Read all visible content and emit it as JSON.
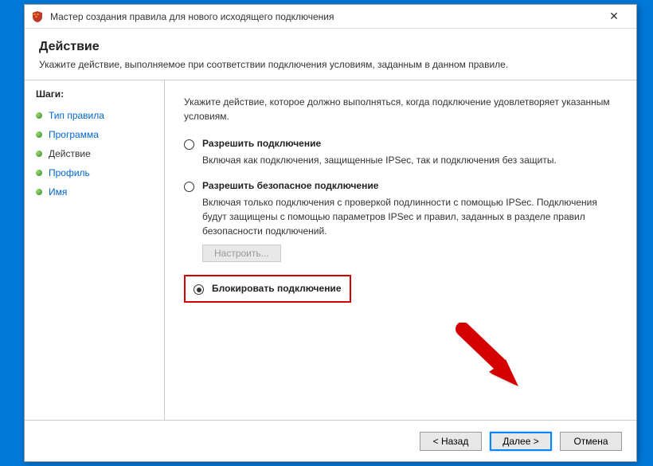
{
  "window": {
    "title": "Мастер создания правила для нового исходящего подключения",
    "close_symbol": "✕"
  },
  "header": {
    "title": "Действие",
    "subtitle": "Укажите действие, выполняемое при соответствии подключения условиям, заданным в данном правиле."
  },
  "sidebar": {
    "title": "Шаги:",
    "steps": [
      {
        "label": "Тип правила",
        "current": false
      },
      {
        "label": "Программа",
        "current": false
      },
      {
        "label": "Действие",
        "current": true
      },
      {
        "label": "Профиль",
        "current": false
      },
      {
        "label": "Имя",
        "current": false
      }
    ]
  },
  "content": {
    "intro": "Укажите действие, которое должно выполняться, когда подключение удовлетворяет указанным условиям.",
    "options": [
      {
        "label": "Разрешить подключение",
        "desc": "Включая как подключения, защищенные IPSec, так и подключения без защиты.",
        "checked": false
      },
      {
        "label": "Разрешить безопасное подключение",
        "desc": "Включая только подключения с проверкой подлинности с помощью IPSec. Подключения будут защищены с помощью параметров IPSec и правил, заданных в разделе правил безопасности подключений.",
        "checked": false,
        "customize": "Настроить..."
      },
      {
        "label": "Блокировать подключение",
        "desc": "",
        "checked": true
      }
    ]
  },
  "footer": {
    "back": "< Назад",
    "next": "Далее >",
    "cancel": "Отмена"
  }
}
